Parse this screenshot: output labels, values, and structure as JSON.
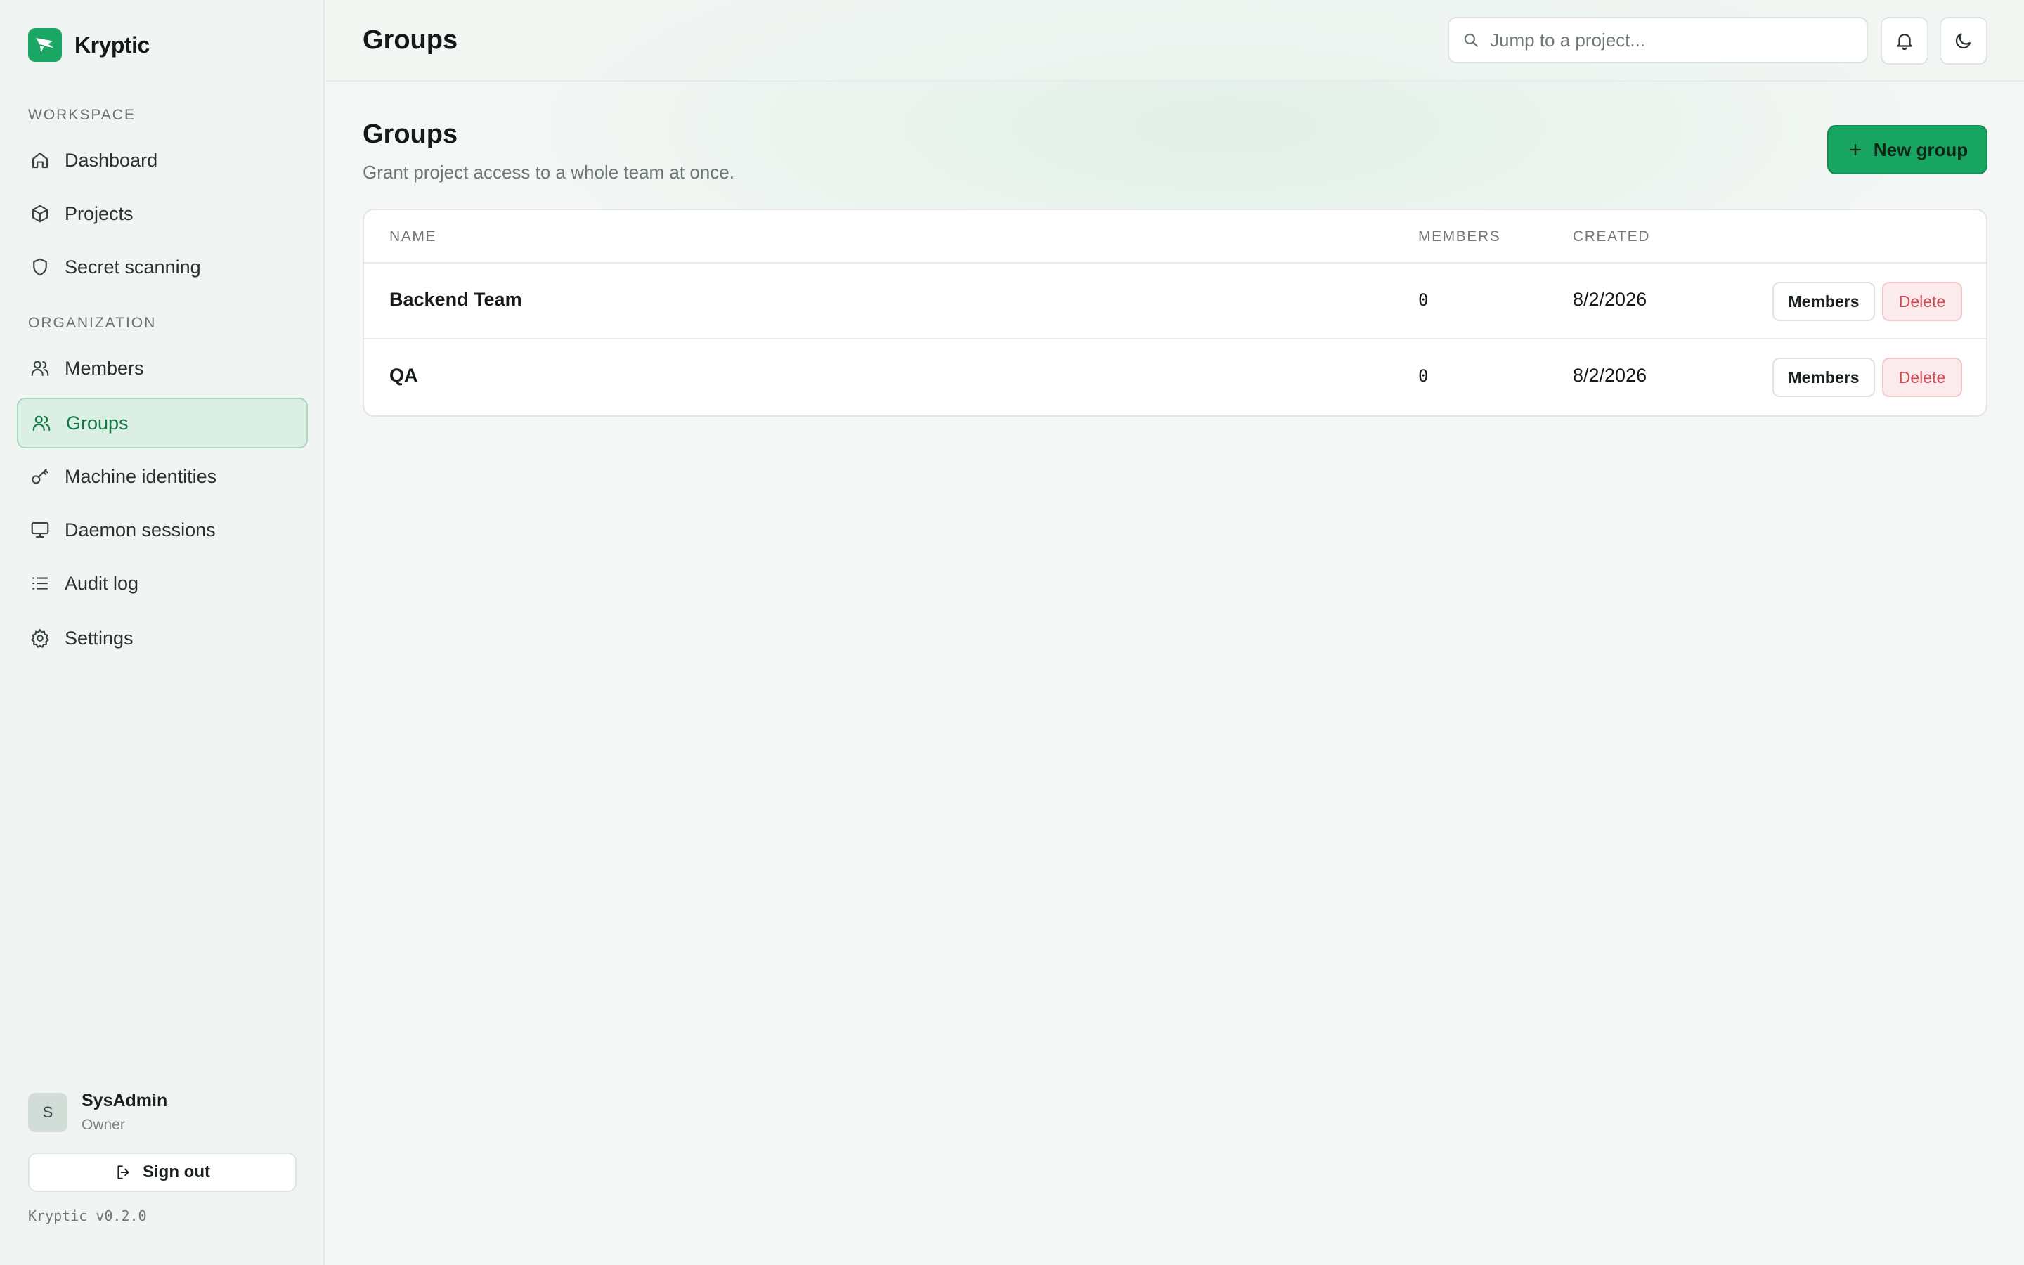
{
  "brand": {
    "name": "Kryptic"
  },
  "sidebar": {
    "sections": [
      {
        "label": "WORKSPACE"
      },
      {
        "label": "ORGANIZATION"
      }
    ],
    "items": [
      {
        "label": "Dashboard",
        "icon": "home-icon"
      },
      {
        "label": "Projects",
        "icon": "cube-icon"
      },
      {
        "label": "Secret scanning",
        "icon": "shield-icon"
      },
      {
        "label": "Members",
        "icon": "users-icon"
      },
      {
        "label": "Groups",
        "icon": "users-icon",
        "active": true
      },
      {
        "label": "Machine identities",
        "icon": "key-icon"
      },
      {
        "label": "Daemon sessions",
        "icon": "monitor-icon"
      },
      {
        "label": "Audit log",
        "icon": "list-icon"
      },
      {
        "label": "Settings",
        "icon": "gear-icon"
      }
    ],
    "user": {
      "initial": "S",
      "name": "SysAdmin",
      "role": "Owner"
    },
    "signout_label": "Sign out",
    "version": "Kryptic v0.2.0"
  },
  "topbar": {
    "title": "Groups",
    "search_placeholder": "Jump to a project..."
  },
  "page": {
    "title": "Groups",
    "subtitle": "Grant project access to a whole team at once.",
    "new_button_label": "New group"
  },
  "table": {
    "columns": [
      "NAME",
      "MEMBERS",
      "CREATED"
    ],
    "rows": [
      {
        "name": "Backend Team",
        "members": "0",
        "created": "8/2/2026",
        "members_btn": "Members",
        "delete_btn": "Delete"
      },
      {
        "name": "QA",
        "members": "0",
        "created": "8/2/2026",
        "members_btn": "Members",
        "delete_btn": "Delete"
      }
    ]
  },
  "colors": {
    "accent": "#17a561",
    "active_bg": "#dcefe4",
    "danger": "#d04a54"
  }
}
